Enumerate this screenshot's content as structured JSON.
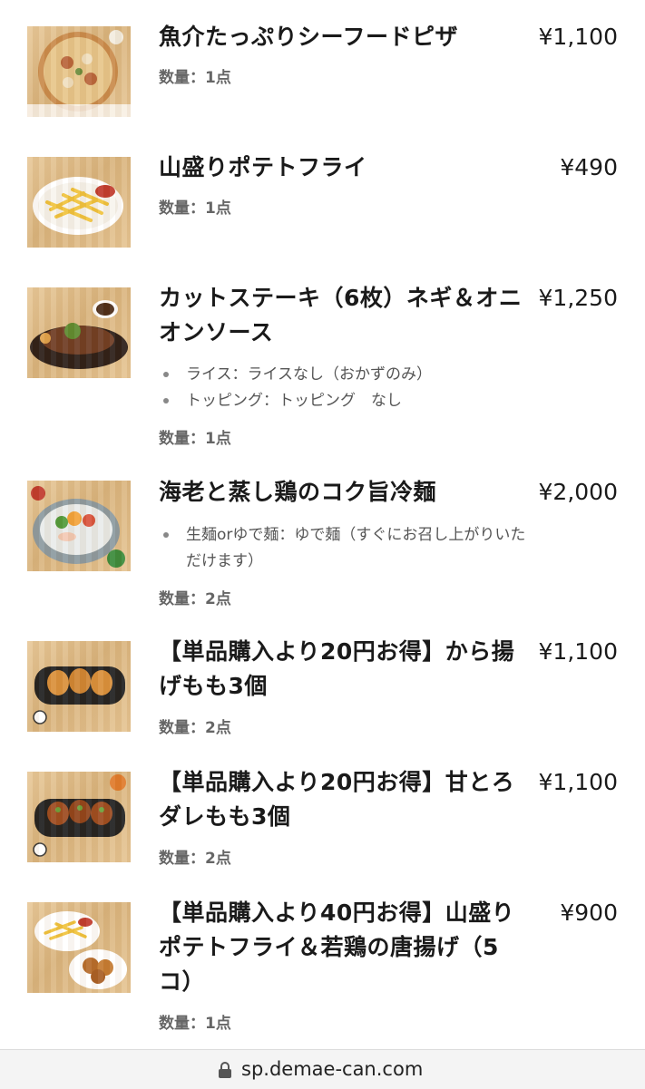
{
  "items": [
    {
      "title": "魚介たっぷりシーフードピザ",
      "price": "¥1,100",
      "options": [],
      "quantity": "数量：1点",
      "image_icon": "seafood-pizza-photo"
    },
    {
      "title": "山盛りポテトフライ",
      "price": "¥490",
      "options": [],
      "quantity": "数量：1点",
      "image_icon": "french-fries-photo"
    },
    {
      "title": "カットステーキ（6枚）ネギ＆オニオンソース",
      "price": "¥1,250",
      "options": [
        "ライス：ライスなし（おかずのみ）",
        "トッピング：トッピング　なし"
      ],
      "quantity": "数量：1点",
      "image_icon": "cut-steak-photo"
    },
    {
      "title": "海老と蒸し鶏のコク旨冷麺",
      "price": "¥2,000",
      "options": [
        "生麺orゆで麺：ゆで麺（すぐにお召し上がりいただけます）"
      ],
      "quantity": "数量：2点",
      "image_icon": "cold-noodle-photo"
    },
    {
      "title": "【単品購入より20円お得】から揚げもも3個",
      "price": "¥1,100",
      "options": [],
      "quantity": "数量：2点",
      "image_icon": "karaage-photo"
    },
    {
      "title": "【単品購入より20円お得】甘とろダレもも3個",
      "price": "¥1,100",
      "options": [],
      "quantity": "数量：2点",
      "image_icon": "sauce-karaage-photo"
    },
    {
      "title": "【単品購入より40円お得】山盛りポテトフライ＆若鶏の唐揚げ（5コ）",
      "price": "¥900",
      "options": [],
      "quantity": "数量：1点",
      "image_icon": "fries-and-karaage-photo"
    }
  ],
  "browser": {
    "url": "sp.demae-can.com",
    "lock_icon": "lock-icon"
  }
}
